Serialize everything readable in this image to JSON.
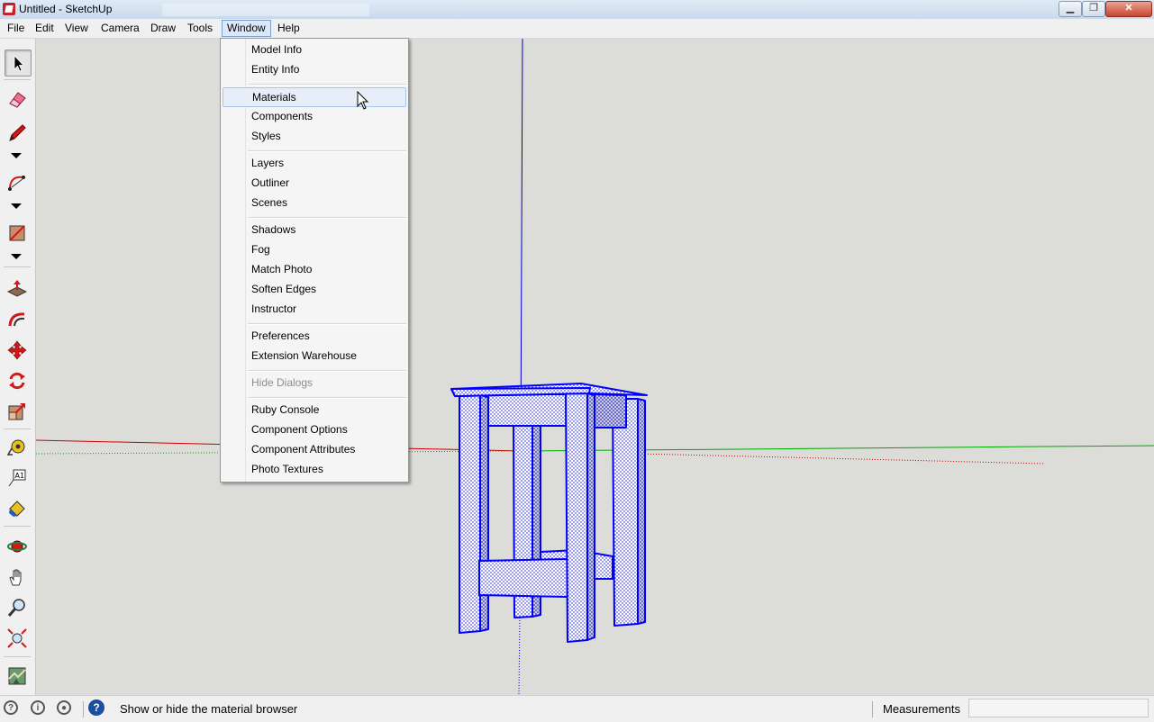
{
  "window": {
    "title": "Untitled - SketchUp"
  },
  "menubar": {
    "items": [
      "File",
      "Edit",
      "View",
      "Camera",
      "Draw",
      "Tools",
      "Window",
      "Help"
    ],
    "active": "Window"
  },
  "window_menu": {
    "groups": [
      [
        "Model Info",
        "Entity Info"
      ],
      [
        "Materials",
        "Components",
        "Styles"
      ],
      [
        "Layers",
        "Outliner",
        "Scenes"
      ],
      [
        "Shadows",
        "Fog",
        "Match Photo",
        "Soften Edges",
        "Instructor"
      ],
      [
        "Preferences",
        "Extension Warehouse"
      ],
      [
        "Hide Dialogs"
      ],
      [
        "Ruby Console",
        "Component Options",
        "Component Attributes",
        "Photo Textures"
      ]
    ],
    "hovered": "Materials",
    "disabled": [
      "Hide Dialogs"
    ]
  },
  "toolbar": {
    "tools": [
      "select-icon",
      "eraser-icon",
      "pencil-icon",
      "arc-icon",
      "rectangle-icon",
      "push-pull-icon",
      "follow-me-icon",
      "move-icon",
      "rotate-icon",
      "scale-icon",
      "tape-measure-icon",
      "text-icon",
      "paint-bucket-icon",
      "orbit-icon",
      "pan-icon",
      "zoom-icon",
      "zoom-extents-icon",
      "location-icon"
    ]
  },
  "statusbar": {
    "hint": "Show or hide the material browser",
    "measurements_label": "Measurements",
    "measurements_value": ""
  },
  "colors": {
    "selection": "#0000ff",
    "axis_red": "#cc0000",
    "axis_green": "#00aa00",
    "axis_blue": "#0000cc",
    "viewport_bg": "#dcdcd8"
  }
}
